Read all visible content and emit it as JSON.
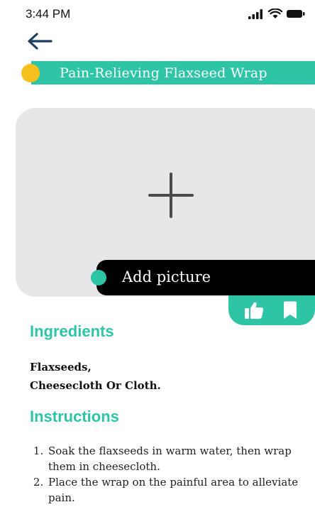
{
  "status_bar": {
    "time": "3:44 PM",
    "icons": [
      "signal-icon",
      "wifi-icon",
      "battery-icon"
    ]
  },
  "header": {
    "back_icon": "arrow-left-icon",
    "title": "Pain-Relieving Flaxseed Wrap"
  },
  "picture": {
    "plus_icon": "plus-icon",
    "add_label": "Add picture"
  },
  "actions": {
    "like_icon": "thumbs-up-icon",
    "bookmark_icon": "bookmark-icon"
  },
  "ingredients": {
    "heading": "Ingredients",
    "items": [
      "Flaxseeds,",
      "Cheesecloth Or Cloth."
    ]
  },
  "instructions": {
    "heading": "Instructions",
    "steps": [
      "Soak the flaxseeds in warm water, then wrap them in cheesecloth.",
      "Place the wrap on the painful area to alleviate pain."
    ]
  },
  "colors": {
    "accent": "#2ec4a6",
    "dot_yellow": "#f6c11d",
    "picture_bg": "#e7e6e8",
    "add_bar": "#000000"
  }
}
